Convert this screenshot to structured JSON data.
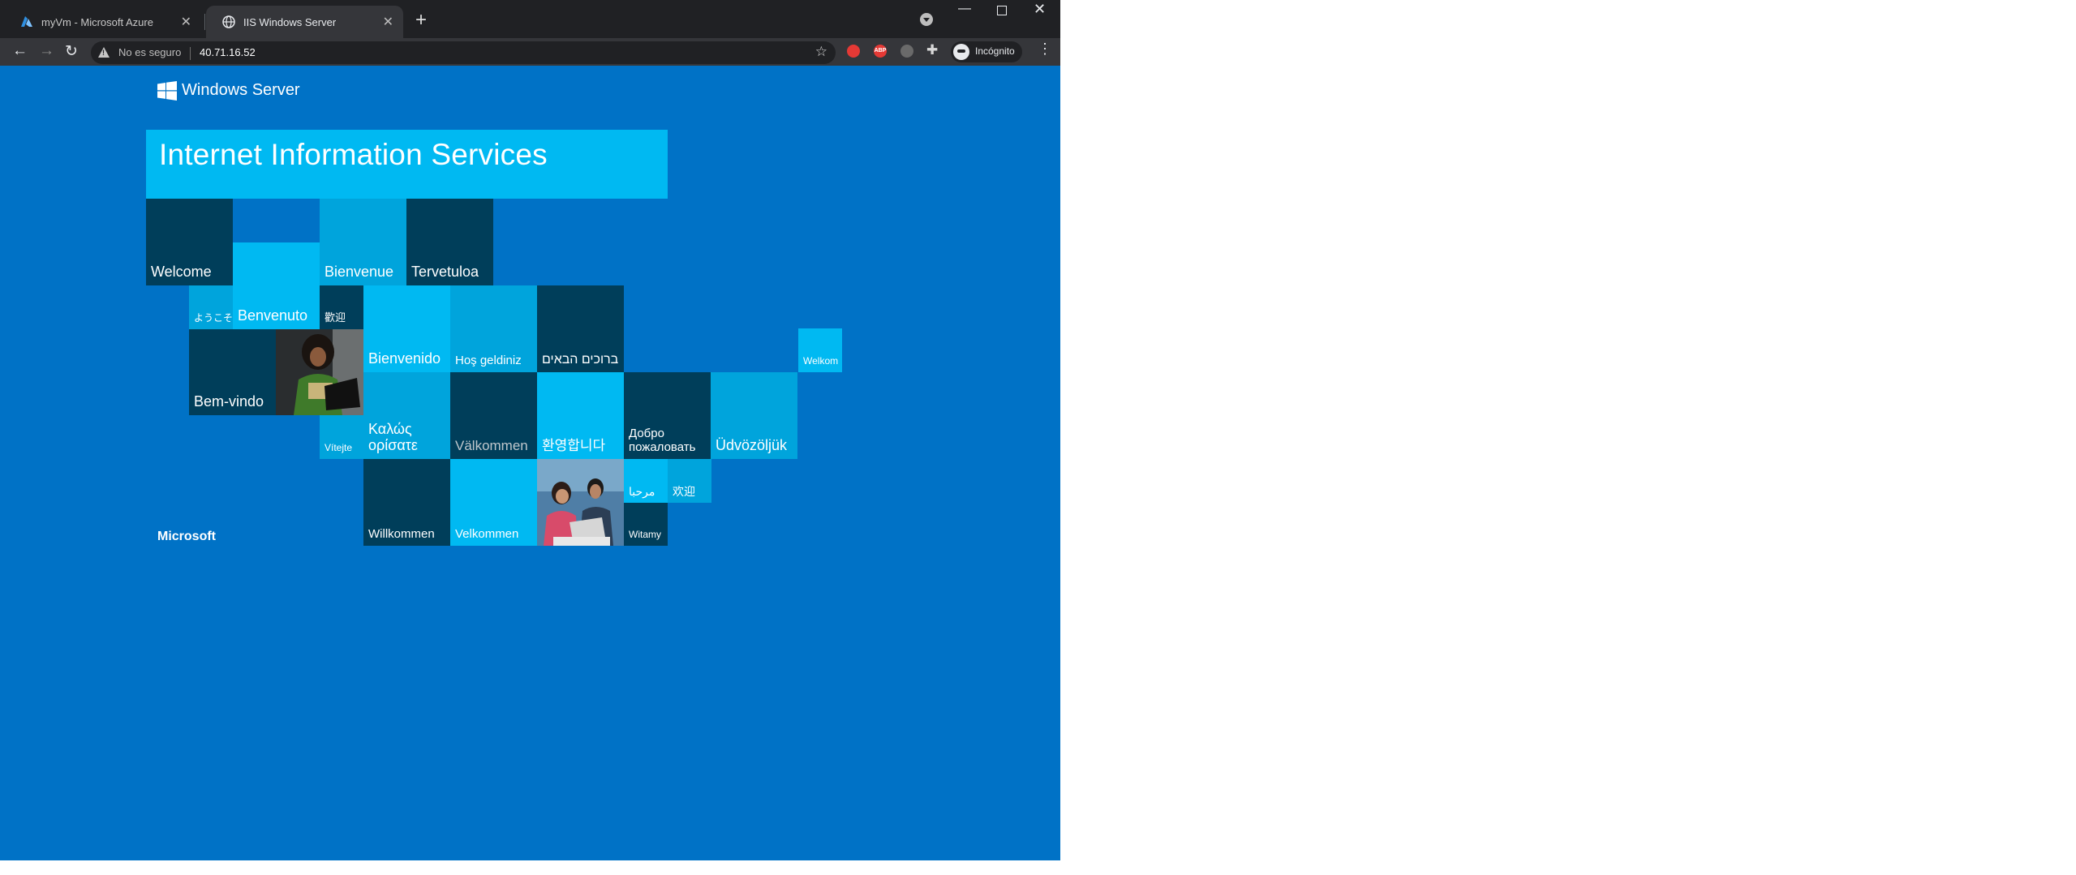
{
  "browser": {
    "tabs": [
      {
        "title": "myVm - Microsoft Azure",
        "active": false
      },
      {
        "title": "IIS Windows Server",
        "active": true
      }
    ],
    "address": {
      "security_label": "No es seguro",
      "url": "40.71.16.52"
    },
    "profile_label": "Incógnito",
    "ext_abp_label": "ABP"
  },
  "iis": {
    "brand": "Windows Server",
    "title": "Internet Information Services",
    "footer": "Microsoft",
    "tiles": {
      "welcome": "Welcome",
      "bienvenue": "Bienvenue",
      "tervetuloa": "Tervetuloa",
      "youkoso": "ようこそ",
      "benvenuto": "Benvenuto",
      "kangei_tw": "歡迎",
      "bienvenido": "Bienvenido",
      "hos_geldiniz": "Hoş geldiniz",
      "hebrew": "ברוכים הבאים",
      "welkom": "Welkom",
      "bem_vindo": "Bem-vindo",
      "vitejte": "Vítejte",
      "greek_line1": "Καλώς",
      "greek_line2": "ορίσατε",
      "valkommen": "Välkommen",
      "korean": "환영합니다",
      "russian_line1": "Добро",
      "russian_line2": "пожаловать",
      "udvozoljuk": "Üdvözöljük",
      "arabic": "مرحبا",
      "huanying": "欢迎",
      "willkommen": "Willkommen",
      "velkommen": "Velkommen",
      "witamy": "Witamy"
    }
  },
  "colors": {
    "page_bg": "#0072c6",
    "tile_dark": "#003e5a",
    "tile_cyan": "#00b9f2",
    "tile_mid": "#00a4dc"
  },
  "icons": [
    "azure-icon",
    "globe-icon",
    "warning-icon",
    "star-icon",
    "windows-logo-icon",
    "extensions-icon",
    "incognito-icon"
  ]
}
